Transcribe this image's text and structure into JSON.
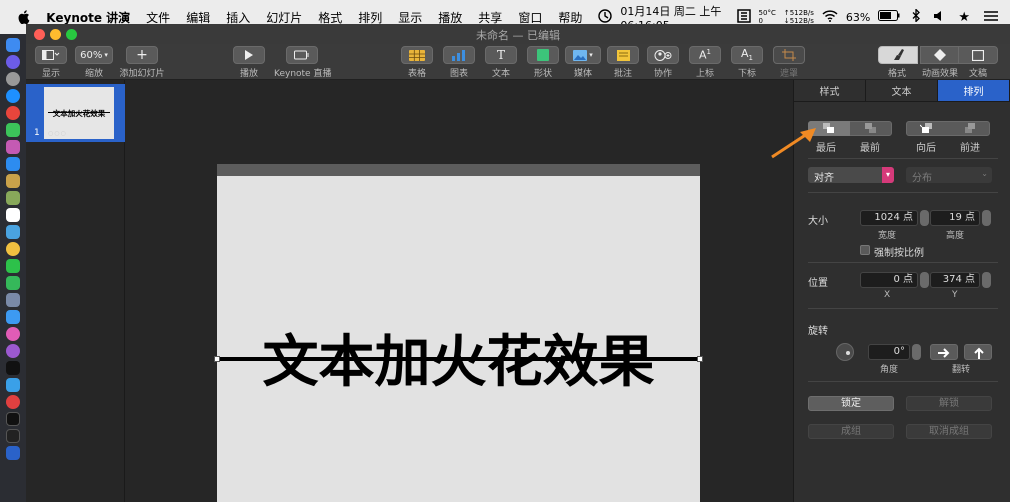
{
  "menubar": {
    "app_name": "Keynote 讲演",
    "items": [
      "文件",
      "编辑",
      "插入",
      "幻灯片",
      "格式",
      "排列",
      "显示",
      "播放",
      "共享",
      "窗口",
      "帮助"
    ],
    "datetime": "01月14日 周二 上午06:16:05",
    "temp_line1": "50°C",
    "temp_line2": "0",
    "net_up": "↑512B/s",
    "net_down": "↓512B/s",
    "battery": "63%"
  },
  "window": {
    "title": "未命名 — 已编辑"
  },
  "toolbar": {
    "view_label": "显示",
    "zoom_value": "60%",
    "zoom_label": "缩放",
    "add_slide_label": "添加幻灯片",
    "play_label": "播放",
    "live_label": "Keynote 直播",
    "table_label": "表格",
    "chart_label": "图表",
    "text_label": "文本",
    "shape_label": "形状",
    "media_label": "媒体",
    "comment_label": "批注",
    "collab_label": "协作",
    "superscript_label": "上标",
    "subscript_label": "下标",
    "mask_label": "遮罩",
    "format_label": "格式",
    "animate_label": "动画效果",
    "document_label": "文稿"
  },
  "navigator": {
    "slide_number": "1",
    "thumb_text": "文本加火花效果"
  },
  "slide": {
    "text": "文本加火花效果"
  },
  "inspector": {
    "tabs": [
      "样式",
      "文本",
      "排列"
    ],
    "active_tab": 2,
    "back_label": "最后",
    "front_label": "最前",
    "backward_label": "向后",
    "forward_label": "前进",
    "align_value": "对齐",
    "distribute_value": "分布",
    "size_label": "大小",
    "width_value": "1024 点",
    "height_value": "19 点",
    "width_label": "宽度",
    "height_label": "高度",
    "constrain_label": "强制按比例",
    "position_label": "位置",
    "x_value": "0 点",
    "y_value": "374 点",
    "x_label": "X",
    "y_label": "Y",
    "rotate_label": "旋转",
    "angle_value": "0°",
    "angle_label": "角度",
    "flip_label": "翻转",
    "lock_label": "锁定",
    "unlock_label": "解锁",
    "group_label": "成组",
    "ungroup_label": "取消成组"
  },
  "colors": {
    "accent": "#2a62c9",
    "annotation_arrow": "#f08a24"
  }
}
